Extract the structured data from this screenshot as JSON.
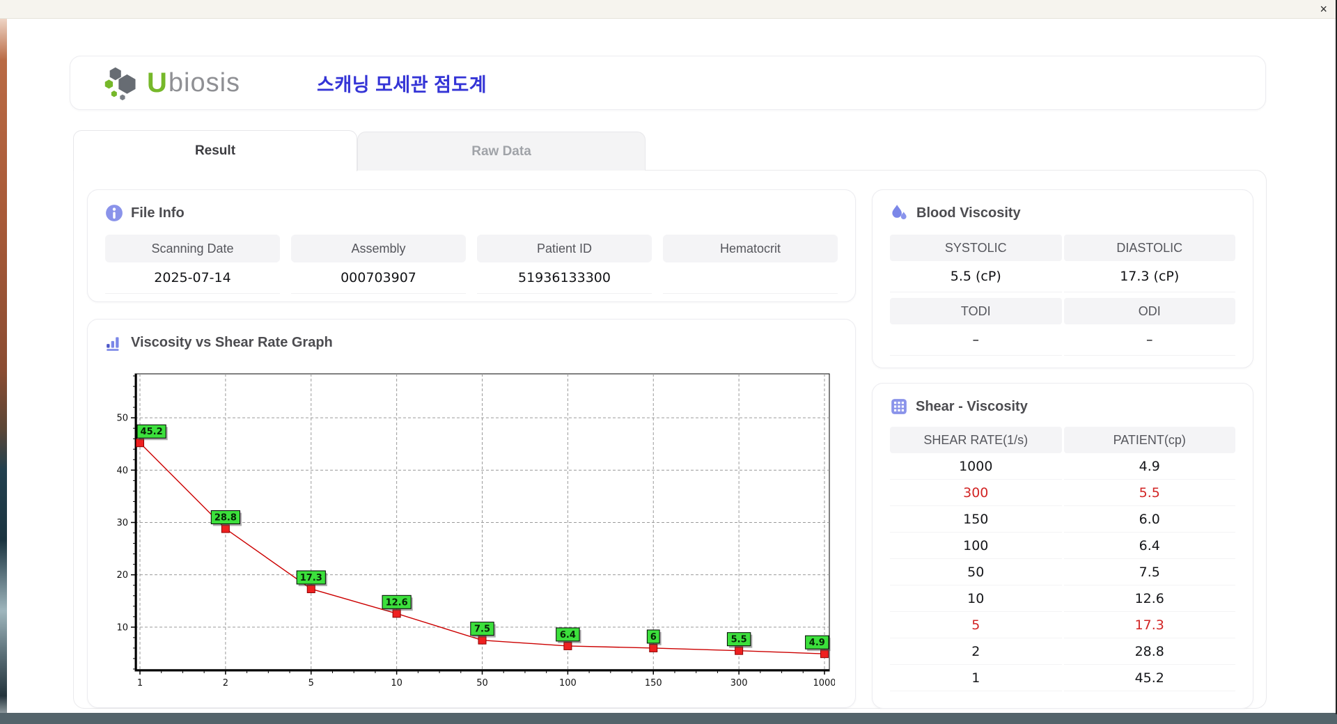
{
  "titlebar": {
    "close_label": "×"
  },
  "header": {
    "logo_u": "U",
    "logo_rest": "biosis",
    "app_title": "스캐닝 모세관 점도계"
  },
  "tabs": {
    "result": "Result",
    "raw_data": "Raw Data"
  },
  "file_info": {
    "title": "File Info",
    "fields": [
      {
        "label": "Scanning Date",
        "value": "2025-07-14"
      },
      {
        "label": "Assembly",
        "value": "000703907"
      },
      {
        "label": "Patient ID",
        "value": "51936133300"
      },
      {
        "label": "Hematocrit",
        "value": ""
      }
    ]
  },
  "graph": {
    "title": "Viscosity vs Shear Rate Graph"
  },
  "blood_viscosity": {
    "title": "Blood Viscosity",
    "groups": [
      {
        "left_label": "SYSTOLIC",
        "left_value": "5.5 (cP)",
        "right_label": "DIASTOLIC",
        "right_value": "17.3 (cP)"
      },
      {
        "left_label": "TODI",
        "left_value": "–",
        "right_label": "ODI",
        "right_value": "–"
      }
    ]
  },
  "shear_viscosity": {
    "title": "Shear - Viscosity",
    "columns": [
      "SHEAR RATE(1/s)",
      "PATIENT(cp)"
    ],
    "rows": [
      {
        "shear_rate": "1000",
        "patient": "4.9",
        "highlight": false
      },
      {
        "shear_rate": "300",
        "patient": "5.5",
        "highlight": true
      },
      {
        "shear_rate": "150",
        "patient": "6.0",
        "highlight": false
      },
      {
        "shear_rate": "100",
        "patient": "6.4",
        "highlight": false
      },
      {
        "shear_rate": "50",
        "patient": "7.5",
        "highlight": false
      },
      {
        "shear_rate": "10",
        "patient": "12.6",
        "highlight": false
      },
      {
        "shear_rate": "5",
        "patient": "17.3",
        "highlight": true
      },
      {
        "shear_rate": "2",
        "patient": "28.8",
        "highlight": false
      },
      {
        "shear_rate": "1",
        "patient": "45.2",
        "highlight": false
      }
    ]
  },
  "chart_data": {
    "type": "line",
    "title": "Viscosity vs Shear Rate Graph",
    "xlabel": "",
    "ylabel": "",
    "x": [
      1,
      2,
      5,
      10,
      50,
      100,
      150,
      300,
      1000
    ],
    "x_tick_labels": [
      "1",
      "2",
      "5",
      "10",
      "50",
      "100",
      "150",
      "300",
      "1000"
    ],
    "values": [
      45.2,
      28.8,
      17.3,
      12.6,
      7.5,
      6.4,
      6.0,
      5.5,
      4.9
    ],
    "point_labels": [
      "45.2",
      "28.8",
      "17.3",
      "12.6",
      "7.5",
      "6.4",
      "6",
      "5.5",
      "4.9"
    ],
    "y_ticks": [
      10,
      20,
      30,
      40,
      50
    ],
    "ylim": [
      1.6,
      58.4
    ],
    "x_scale": "categorical-even",
    "grid": "dashed",
    "legend": "none",
    "line_color": "#cc0000",
    "marker_color": "#ee2020",
    "marker_border": "#8d0000",
    "label_bg": "#3ce03c"
  },
  "colors": {
    "accent_purple": "#7b87e8",
    "brand_green": "#76b82a",
    "title_blue": "#3434d6",
    "highlight_red": "#d22525"
  }
}
